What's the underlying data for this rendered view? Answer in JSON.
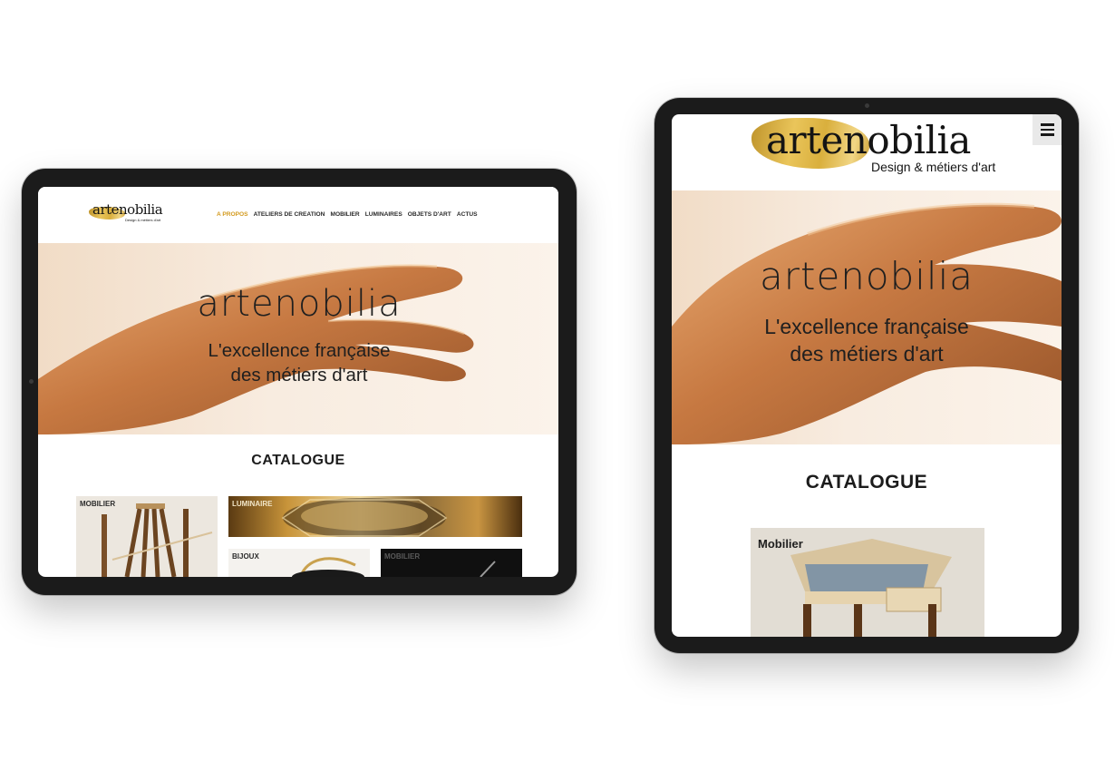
{
  "brand": {
    "name": "artenobilia",
    "tagline": "Design & métiers d'art"
  },
  "landscape": {
    "nav": [
      "A PROPOS",
      "ATELIERS DE CREATION",
      "MOBILIER",
      "LUMINAIRES",
      "OBJETS D'ART",
      "ACTUS"
    ],
    "active_nav": "A PROPOS",
    "hero": {
      "title": "artenobilia",
      "line1": "L'excellence française",
      "line2": "des métiers d'art"
    },
    "catalogue_title": "CATALOGUE",
    "tiles": [
      "MOBILIER",
      "LUMINAIRE",
      "BIJOUX",
      "MOBILIER"
    ]
  },
  "portrait": {
    "menu_icon": "hamburger-menu-icon",
    "hero": {
      "title": "artenobilia",
      "line1": "L'excellence française",
      "line2": "des métiers d'art"
    },
    "catalogue_title": "CATALOGUE",
    "tiles": [
      "Mobilier"
    ]
  },
  "colors": {
    "accent_gold": "#d39a1e",
    "device_frame": "#1b1b1b",
    "hero_bg": "#f8ece0",
    "copper": "#c8783e"
  }
}
